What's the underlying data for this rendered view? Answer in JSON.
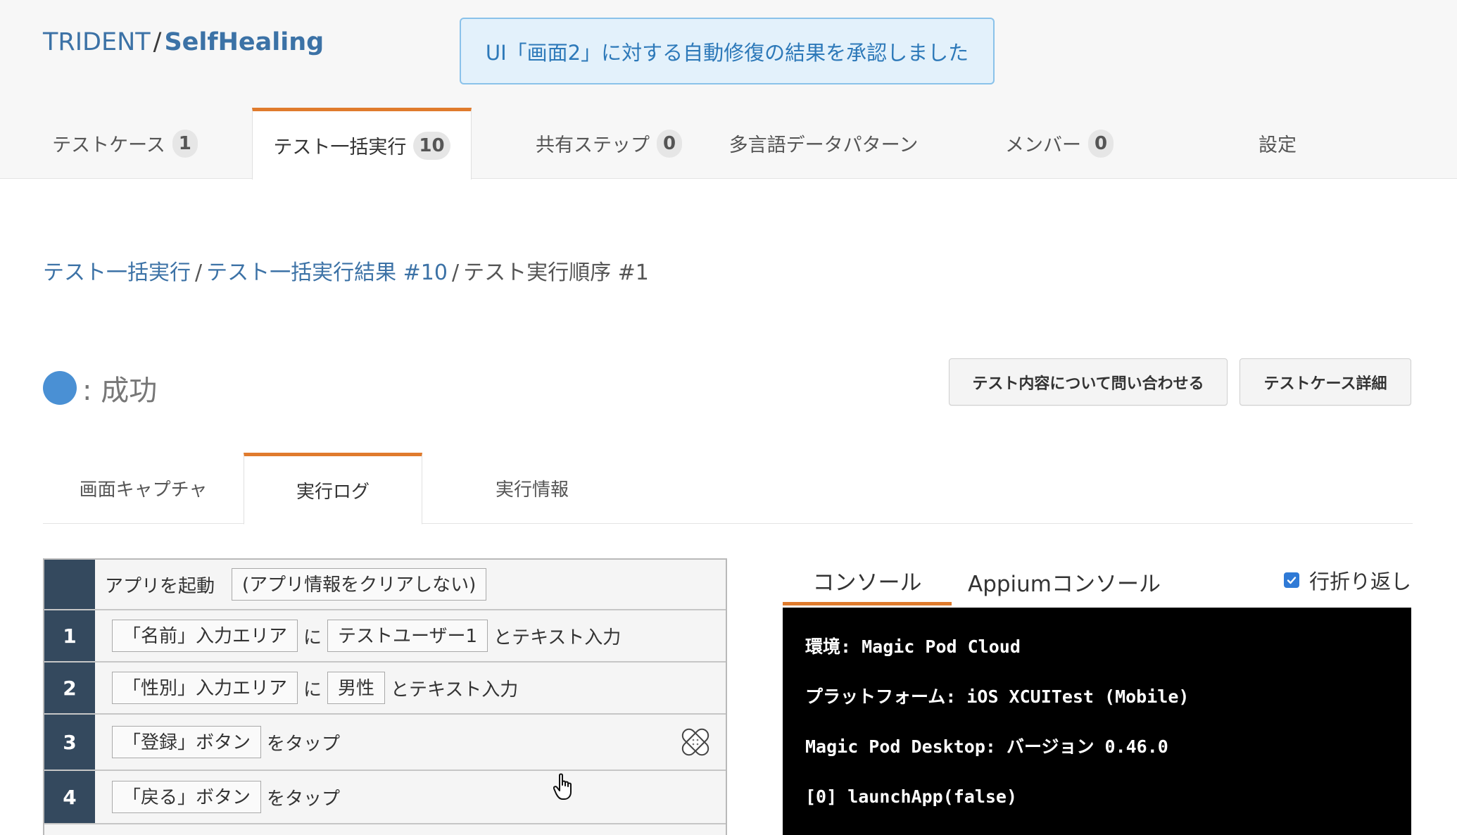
{
  "brand": {
    "org": "TRIDENT",
    "separator": "/",
    "project": "SelfHealing"
  },
  "toast": {
    "message": "UI「画面2」に対する自動修復の結果を承認しました"
  },
  "tabs": [
    {
      "label": "テストケース",
      "count": "1"
    },
    {
      "label": "テスト一括実行",
      "count": "10"
    },
    {
      "label": "共有ステップ",
      "count": "0"
    },
    {
      "label": "多言語データパターン"
    },
    {
      "label": "メンバー",
      "count": "0"
    },
    {
      "label": "設定"
    }
  ],
  "breadcrumb": {
    "items": [
      "テスト一括実行",
      "テスト一括実行結果 #10",
      "テスト実行順序 #1"
    ],
    "separator": "/"
  },
  "status": {
    "label": ": 成功",
    "color": "#4a90d4"
  },
  "actions": {
    "inquire": "テスト内容について問い合わせる",
    "detail": "テストケース詳細"
  },
  "subtabs": [
    "画面キャプチャ",
    "実行ログ",
    "実行情報"
  ],
  "steps": [
    {
      "num": "",
      "parts": [
        {
          "t": "text",
          "v": "アプリを起動"
        },
        {
          "t": "chip",
          "v": "(アプリ情報をクリアしない)"
        }
      ]
    },
    {
      "num": "1",
      "parts": [
        {
          "t": "chip",
          "v": "「名前」入力エリア"
        },
        {
          "t": "text",
          "v": "に"
        },
        {
          "t": "chip",
          "v": "テストユーザー1"
        },
        {
          "t": "text",
          "v": "とテキスト入力"
        }
      ]
    },
    {
      "num": "2",
      "parts": [
        {
          "t": "chip",
          "v": "「性別」入力エリア"
        },
        {
          "t": "text",
          "v": "に"
        },
        {
          "t": "chip",
          "v": "男性"
        },
        {
          "t": "text",
          "v": "とテキスト入力"
        }
      ]
    },
    {
      "num": "3",
      "parts": [
        {
          "t": "chip",
          "v": "「登録」ボタン"
        },
        {
          "t": "text",
          "v": "をタップ"
        }
      ],
      "healed": true
    },
    {
      "num": "4",
      "parts": [
        {
          "t": "chip",
          "v": "「戻る」ボタン"
        },
        {
          "t": "text",
          "v": "をタップ"
        }
      ]
    }
  ],
  "console": {
    "tabs": [
      "コンソール",
      "Appiumコンソール"
    ],
    "wrap_label": "行折り返し",
    "wrap_checked": true,
    "lines": [
      "環境: Magic Pod Cloud",
      "プラットフォーム: iOS XCUITest (Mobile)",
      "Magic Pod Desktop: バージョン 0.46.0",
      "[0] launchApp(false)"
    ]
  },
  "colors": {
    "accent": "#e07b2d",
    "link": "#3c72a6",
    "step_number_bg": "#34495e",
    "toast_bg": "#e3f1fb"
  },
  "icons": {
    "healed_step": "bandage-icon",
    "cursor": "hand-pointer-icon"
  }
}
